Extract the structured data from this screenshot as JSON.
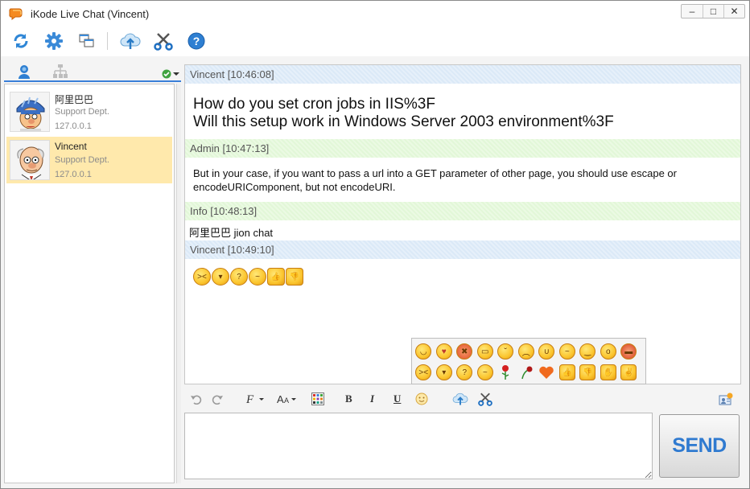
{
  "window": {
    "title": "iKode Live Chat (Vincent)",
    "controls": {
      "minimize": "–",
      "maximize": "□",
      "close": "✕"
    }
  },
  "toolbar": {
    "buttons": [
      "refresh-icon",
      "settings-gear-icon",
      "windows-icon",
      "upload-cloud-icon",
      "screenshot-scissors-icon",
      "help-icon"
    ]
  },
  "left_panel": {
    "status_color": "#3fa33f",
    "contacts": [
      {
        "name": "阿里巴巴",
        "dept": "Support Dept.",
        "ip": "127.0.0.1",
        "active": false
      },
      {
        "name": "Vincent",
        "dept": "Support Dept.",
        "ip": "127.0.0.1",
        "active": true
      }
    ]
  },
  "chat": {
    "messages": [
      {
        "header": "Vincent [10:46:08]",
        "style": "blue",
        "lines": [
          "How do you set cron jobs in IIS%3F",
          "Will this setup work in Windows Server 2003 environment%3F"
        ]
      },
      {
        "header": "Admin [10:47:13]",
        "style": "green",
        "text": "But in your case, if you want to pass a url into a GET parameter of other page, you should use escape or encodeURIComponent, but not encodeURI."
      },
      {
        "header": "Info [10:48:13]",
        "style": "green",
        "text": "阿里巴巴 jion chat"
      },
      {
        "header": "Vincent [10:49:10]",
        "style": "blue",
        "emoticons": 6
      }
    ]
  },
  "colors": {
    "accent": "#3a7fd8",
    "header_blue": "#dbe9f7",
    "header_green": "#e2f7d8",
    "active_contact": "#ffe9ac",
    "send_text": "#2f7ad0"
  },
  "input": {
    "send_label": "SEND"
  }
}
